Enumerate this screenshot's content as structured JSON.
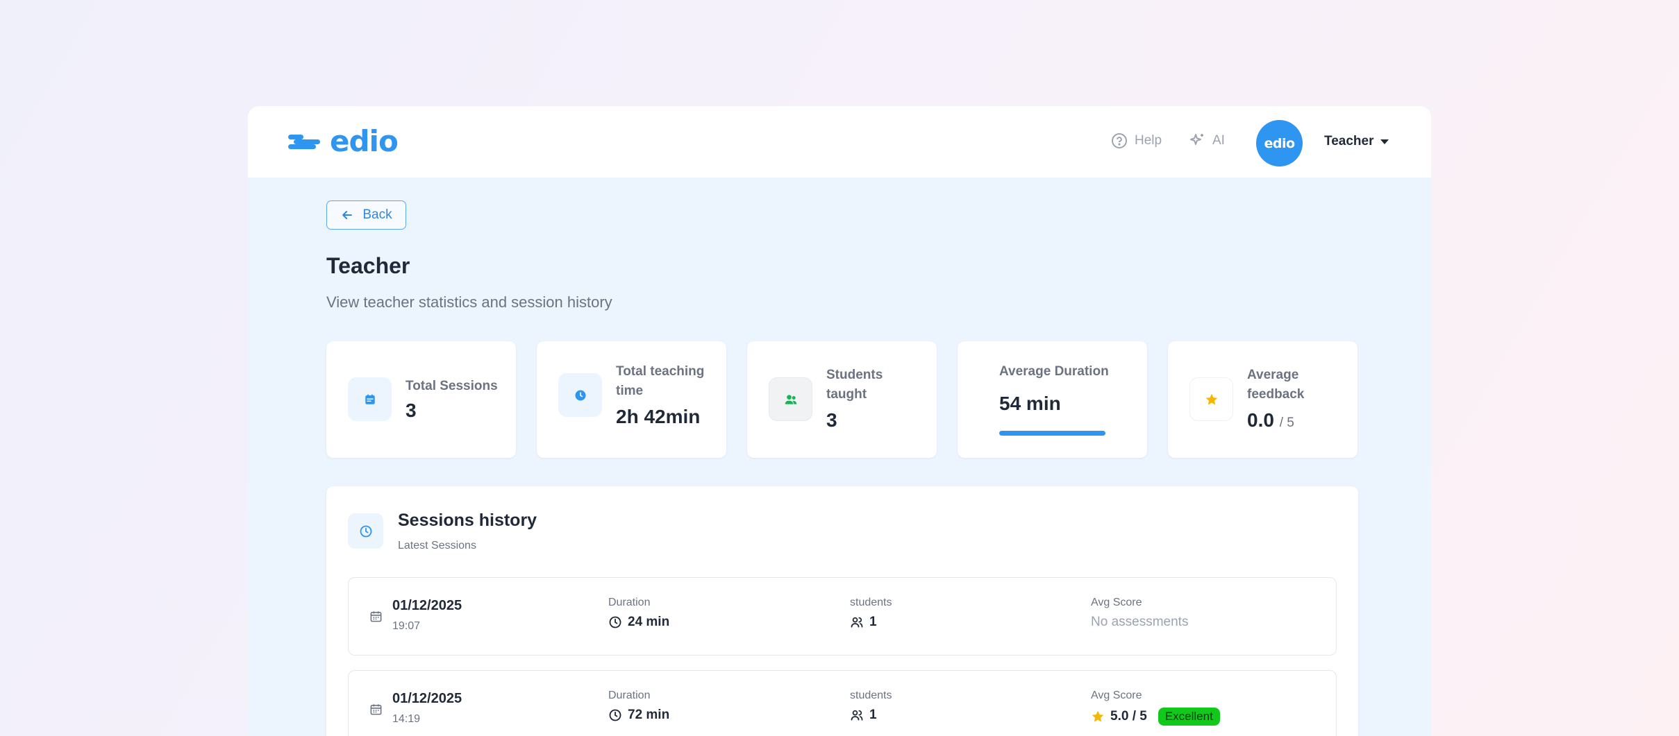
{
  "brand": {
    "name": "edio",
    "color": "#2e95f1"
  },
  "header": {
    "help_label": "Help",
    "ai_label": "AI",
    "avatar_text": "edio",
    "user_label": "Teacher"
  },
  "page": {
    "back_label": "Back",
    "title": "Teacher",
    "subtitle": "View teacher statistics and session history"
  },
  "stats": {
    "total_sessions": {
      "label": "Total Sessions",
      "value": "3",
      "icon": "calendar-icon"
    },
    "teaching_time": {
      "label_line1": "Total teaching",
      "label_line2": "time",
      "value": "2h 42min",
      "icon": "clock-icon"
    },
    "students": {
      "label_line1": "Students",
      "label_line2": "taught",
      "value": "3",
      "icon": "users-icon"
    },
    "avg_duration": {
      "label": "Average Duration",
      "value": "54 min",
      "progress": 1.0
    },
    "avg_feedback": {
      "label_line1": "Average",
      "label_line2": "feedback",
      "value": "0.0",
      "suffix": "/ 5",
      "icon": "star-icon"
    }
  },
  "history": {
    "title": "Sessions history",
    "subtitle": "Latest Sessions",
    "col_duration": "Duration",
    "col_students": "students",
    "col_score": "Avg Score",
    "sessions": [
      {
        "date": "01/12/2025",
        "time": "19:07",
        "duration": "24 min",
        "students": "1",
        "score": "No assessments"
      },
      {
        "date": "01/12/2025",
        "time": "14:19",
        "duration": "72 min",
        "students": "1",
        "score": "5.0 / 5",
        "badge": "Excellent"
      }
    ]
  },
  "colors": {
    "accent": "#2e95f1",
    "success": "#12c91b",
    "star": "#f5b800"
  }
}
